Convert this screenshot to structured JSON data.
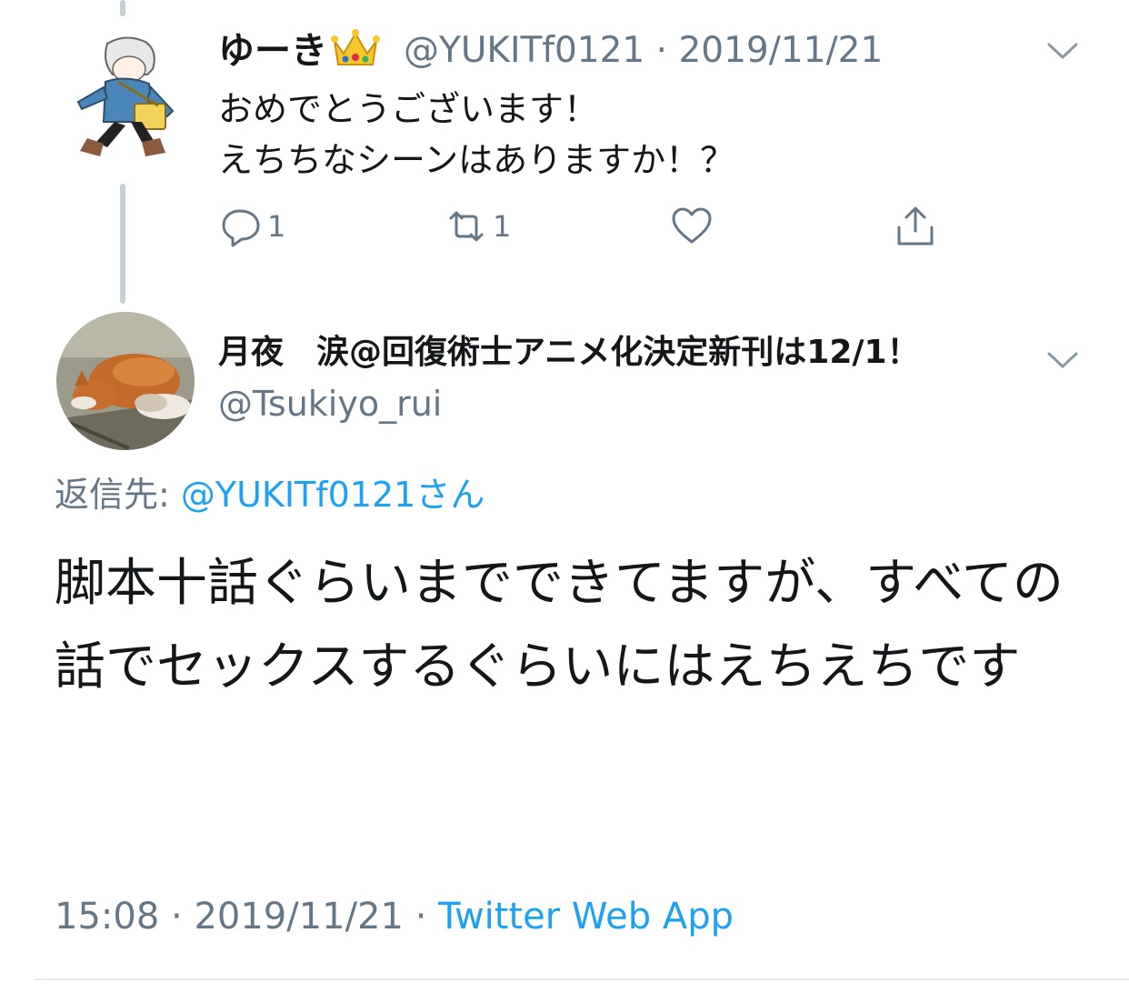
{
  "parent_tweet": {
    "display_name": "ゆーき",
    "name_emoji": "crown-emoji",
    "handle": "@YUKITf0121",
    "separator": "·",
    "date": "2019/11/21",
    "body": "おめでとうございます！\nえちちなシーンはありますか！？",
    "actions": {
      "reply_count": "1",
      "retweet_count": "1",
      "like_count": "",
      "icons": [
        "reply-icon",
        "retweet-icon",
        "like-icon",
        "share-icon"
      ]
    }
  },
  "main_tweet": {
    "display_name": "月夜　涙@回復術士アニメ化決定新刊は12/1！",
    "handle": "@Tsukiyo_rui",
    "reply_label": "返信先:",
    "reply_target": "@YUKITf0121さん",
    "body": "脚本十話ぐらいまでできてますが、すべての話でセックスするぐらいにはえちえちです",
    "time": "15:08",
    "separator": "·",
    "date": "2019/11/21",
    "separator2": "·",
    "source": "Twitter Web App"
  },
  "colors": {
    "accent": "#1da1f2",
    "secondary_text": "#657786",
    "thread_line": "#c4cfd6"
  }
}
